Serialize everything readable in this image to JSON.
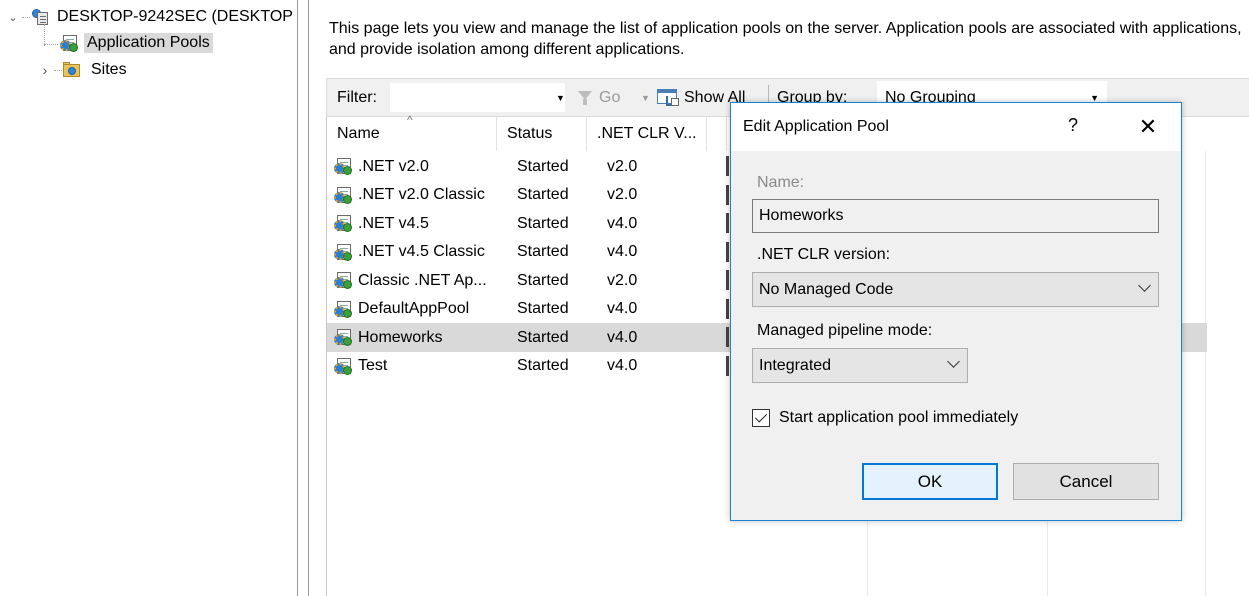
{
  "tree": {
    "server_label": "DESKTOP-9242SEC (DESKTOP",
    "app_pools_label": "Application Pools",
    "sites_label": "Sites"
  },
  "main": {
    "description": "This page lets you view and manage the list of application pools on the server. Application pools are associated with applications, and provide isolation among different applications."
  },
  "filterbar": {
    "filter_label": "Filter:",
    "filter_value": "",
    "go_label": "Go",
    "show_all_label": "Show All",
    "group_by_label": "Group by:",
    "group_by_value": "No Grouping"
  },
  "list": {
    "columns": [
      "Name",
      "Status",
      ".NET CLR V..."
    ],
    "rows": [
      {
        "name": ".NET v2.0",
        "status": "Started",
        "clr": "v2.0"
      },
      {
        "name": ".NET v2.0 Classic",
        "status": "Started",
        "clr": "v2.0"
      },
      {
        "name": ".NET v4.5",
        "status": "Started",
        "clr": "v4.0"
      },
      {
        "name": ".NET v4.5 Classic",
        "status": "Started",
        "clr": "v4.0"
      },
      {
        "name": "Classic .NET Ap...",
        "status": "Started",
        "clr": "v2.0"
      },
      {
        "name": "DefaultAppPool",
        "status": "Started",
        "clr": "v4.0"
      },
      {
        "name": "Homeworks",
        "status": "Started",
        "clr": "v4.0"
      },
      {
        "name": "Test",
        "status": "Started",
        "clr": "v4.0"
      }
    ],
    "selected_row": 6
  },
  "dialog": {
    "title": "Edit Application Pool",
    "help_glyph": "?",
    "close_glyph": "✕",
    "name_label": "Name:",
    "name_value": "Homeworks",
    "clr_label": ".NET CLR version:",
    "clr_value": "No Managed Code",
    "pipeline_label": "Managed pipeline mode:",
    "pipeline_value": "Integrated",
    "start_label": "Start application pool immediately",
    "start_checked": true,
    "ok_label": "OK",
    "cancel_label": "Cancel"
  },
  "colors": {
    "dialog_border": "#1883d7",
    "selection": "#d9d9d9",
    "default_button_border": "#0078d7"
  }
}
